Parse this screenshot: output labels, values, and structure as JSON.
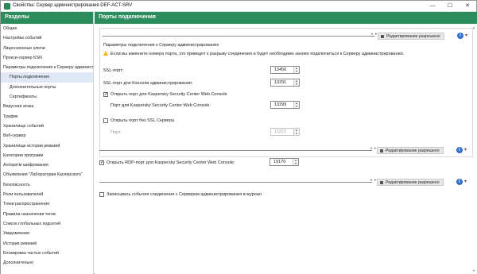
{
  "window": {
    "title": "Свойства: Сервер администрирования DEF-ACT-SRV",
    "minimize": "—",
    "maximize": "☐",
    "close": "✕"
  },
  "sidebar": {
    "header": "Разделы",
    "items": [
      {
        "label": "Общие"
      },
      {
        "label": "Настройка событий"
      },
      {
        "label": "Лицензионные ключи"
      },
      {
        "label": "Прокси-сервер KSN"
      },
      {
        "label": "Параметры подключения к Серверу администрирования"
      },
      {
        "label": "Порты подключения",
        "sub": true,
        "selected": true
      },
      {
        "label": "Дополнительные порты",
        "sub": true
      },
      {
        "label": "Сертификаты",
        "sub": true
      },
      {
        "label": "Вирусная атака"
      },
      {
        "label": "Трафик"
      },
      {
        "label": "Хранилище событий"
      },
      {
        "label": "Веб-сервер"
      },
      {
        "label": "Хранилище истории ревизий"
      },
      {
        "label": "Категории программ"
      },
      {
        "label": "Алгоритм шифрования"
      },
      {
        "label": "Объявления \"Лаборатории Касперского\""
      },
      {
        "label": "Безопасность"
      },
      {
        "label": "Роли пользователей"
      },
      {
        "label": "Точки распространения"
      },
      {
        "label": "Правила назначения тегов"
      },
      {
        "label": "Список глобальных подсетей"
      },
      {
        "label": "Уведомление"
      },
      {
        "label": "История ревизий"
      },
      {
        "label": "Блокировка частых событий"
      },
      {
        "label": "Дополнительно"
      }
    ]
  },
  "main": {
    "title": "Порты подключения",
    "edit_label": "Редактирование разрешено",
    "info_symbol": "i",
    "group": {
      "title": "Параметры подключения к Серверу администрирования",
      "warning": "Если вы измените номера порта, это приведет к разрыву соединения и будет необходимо заново подключиться к Серверу администрирования.",
      "ssl_port_label": "SSL-порт:",
      "ssl_port_value": "13456",
      "console_port_label": "SSL-порт для Консоли администрирования:",
      "console_port_value": "13291",
      "web_console_check_label": "Открыть порт для Kaspersky Security Center Web Console",
      "web_console_port_label": "Порт для Kaspersky Security Center Web Console:",
      "web_console_port_value": "13299",
      "no_ssl_check_label": "Открыть порт без SSL Сервера",
      "no_ssl_port_label": "Порт:",
      "no_ssl_port_value": "11223"
    },
    "rdp": {
      "label": "Открыть RDP-порт для Kaspersky Security Center Web Console:",
      "value": "19170"
    },
    "log": {
      "label": "Записывать события соединения с Сервером администрирования в журнал"
    }
  }
}
